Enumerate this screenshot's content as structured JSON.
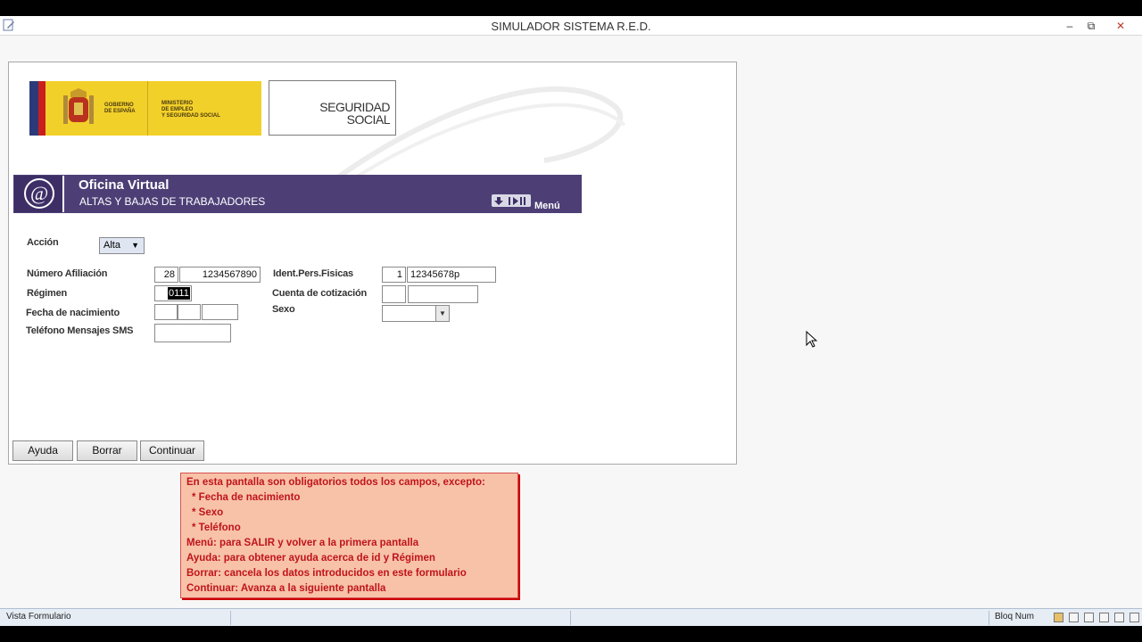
{
  "window": {
    "title": "SIMULADOR SISTEMA R.E.D.",
    "minimize": "–",
    "restore": "⧉",
    "close": "✕"
  },
  "logos": {
    "gobierno": "GOBIERNO\nDE ESPAÑA",
    "ministerio": "MINISTERIO\nDE EMPLEO\nY SEGURIDAD SOCIAL",
    "seguridad_social_1": "SEGURIDAD",
    "seguridad_social_2": "SOCIAL"
  },
  "banner": {
    "title": "Oficina Virtual",
    "subtitle": "ALTAS Y BAJAS DE TRABAJADORES",
    "menu": "Menú"
  },
  "form": {
    "accion_label": "Acción",
    "accion_value": "Alta",
    "afiliacion_label": "Número Afiliación",
    "afiliacion_prov": "28",
    "afiliacion_num": "1234567890",
    "regimen_label": "Régimen",
    "regimen_value": "0111",
    "fecha_label": "Fecha de nacimiento",
    "telefono_label": "Teléfono Mensajes SMS",
    "ident_label": "Ident.Pers.Fisicas",
    "ident_type": "1",
    "ident_value": "12345678p",
    "cuenta_label": "Cuenta de cotización",
    "sexo_label": "Sexo"
  },
  "buttons": {
    "ayuda": "Ayuda",
    "borrar": "Borrar",
    "continuar": "Continuar"
  },
  "note": {
    "line1": "En esta pantalla son obligatorios todos los campos, excepto:",
    "bullet1": "*  Fecha de nacimiento",
    "bullet2": "*  Sexo",
    "bullet3": "*  Teléfono",
    "line2": "Menú: para SALIR y volver a la primera pantalla",
    "line3": "Ayuda: para obtener ayuda acerca de id y Régimen",
    "line4": "Borrar: cancela los datos introducidos en este formulario",
    "line5": "Continuar: Avanza a la siguiente pantalla"
  },
  "status": {
    "left": "Vista Formulario",
    "right": "Bloq Num"
  },
  "colors": {
    "banner": "#4d3f76",
    "note_bg": "#f7c2a8",
    "note_text": "#c0141c"
  }
}
